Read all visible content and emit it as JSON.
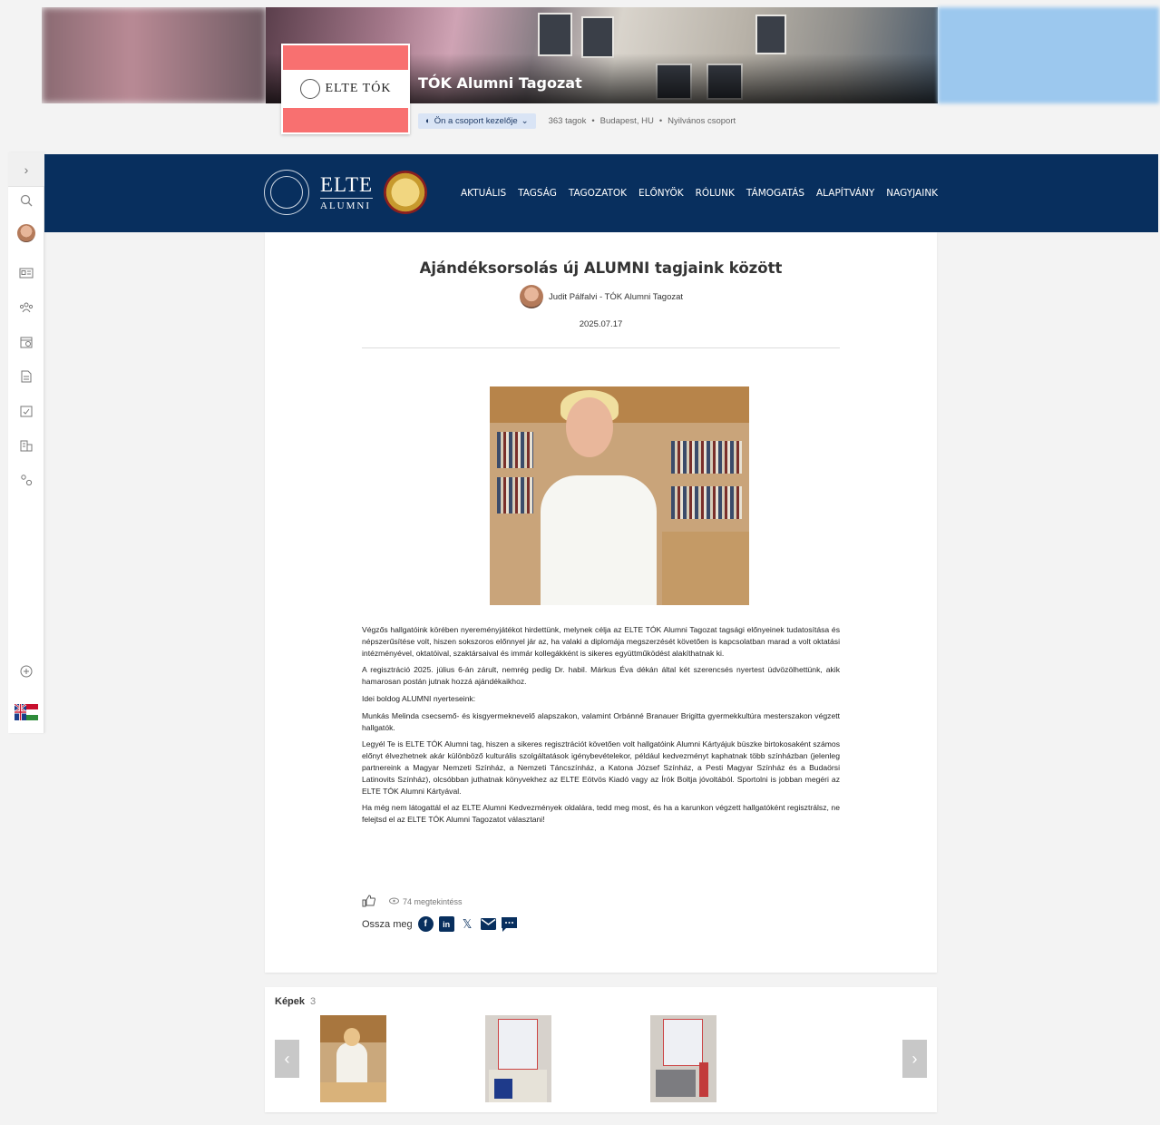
{
  "group": {
    "title": "TÓK Alumni Tagozat",
    "logo_text": "ELTE TÓK",
    "admin_label": "Ön a csoport kezelője",
    "members": "363 tagok",
    "location": "Budapest, HU",
    "visibility": "Nyilvános csoport"
  },
  "navbar": {
    "brand_big": "ELTE",
    "brand_small": "ALUMNI",
    "links": [
      "AKTUÁLIS",
      "TAGSÁG",
      "TAGOZATOK",
      "ELŐNYÖK",
      "RÓLUNK",
      "TÁMOGATÁS",
      "ALAPÍTVÁNY",
      "NAGYJAINK"
    ]
  },
  "article": {
    "title": "Ajándéksorsolás új ALUMNI tagjaink között",
    "author": "Judit Pálfalvi - TÓK Alumni Tagozat",
    "date": "2025.07.17",
    "paragraphs": [
      "Végzős hallgatóink körében nyereményjátékot hirdettünk, melynek célja az ELTE TÓK Alumni Tagozat tagsági előnyeinek tudatosítása és népszerűsítése volt, hiszen sokszoros előnnyel jár az, ha valaki a diplomája megszerzését követően is kapcsolatban marad a volt oktatási intézményével, oktatóival, szaktársaival és immár kollegákként is sikeres együttműködést alakíthatnak ki.",
      "A regisztráció 2025. július 6-án zárult, nemrég pedig Dr. habil. Márkus Éva dékán által két szerencsés nyertest üdvözölhettünk, akik hamarosan postán jutnak hozzá ajándékaikhoz.",
      "Idei boldog ALUMNI nyerteseink:",
      "Munkás Melinda csecsemő- és kisgyermeknevelő alapszakon, valamint Orbánné Branauer Brigitta gyermekkultúra mesterszakon végzett hallgatók.",
      "Legyél Te is ELTE TÓK Alumni tag, hiszen a sikeres regisztrációt követően volt hallgatóink Alumni Kártyájuk büszke birtokosaként számos előnyt élvezhetnek akár különböző kulturális szolgáltatások igénybevételekor, például kedvezményt kaphatnak több színházban (jelenleg partnereink a Magyar Nemzeti Színház, a Nemzeti Táncszínház, a Katona József Színház, a Pesti Magyar Színház és a Budaörsi Latinovits Színház), olcsóbban juthatnak könyvekhez az ELTE Eötvös Kiadó vagy az Írók Boltja jóvoltából. Sportolni is jobban megéri az ELTE TÓK Alumni Kártyával.",
      "Ha még nem látogattál el az ELTE Alumni Kedvezmények oldalára, tedd meg most, és ha a karunkon végzett hallgatóként regisztrálsz, ne felejtsd el az ELTE TÓK Alumni Tagozatot választani!"
    ],
    "views": "74 megtekintéss",
    "share_label": "Ossza meg"
  },
  "images": {
    "label": "Képek",
    "count": "3"
  },
  "icons": {
    "rail": [
      "chevron-right-icon",
      "search-icon",
      "avatar",
      "id-card-icon",
      "people-icon",
      "calendar-icon",
      "document-icon",
      "clipboard-check-icon",
      "building-icon",
      "settings-icon",
      "add-circle-icon",
      "flag-icon"
    ],
    "share": [
      "facebook-icon",
      "linkedin-icon",
      "x-icon",
      "email-icon",
      "message-icon"
    ]
  },
  "colors": {
    "navbar": "#082f5e",
    "logo_band": "#f87070",
    "admin_pill": "#d9e4f5",
    "facebook": "#082f5e"
  }
}
